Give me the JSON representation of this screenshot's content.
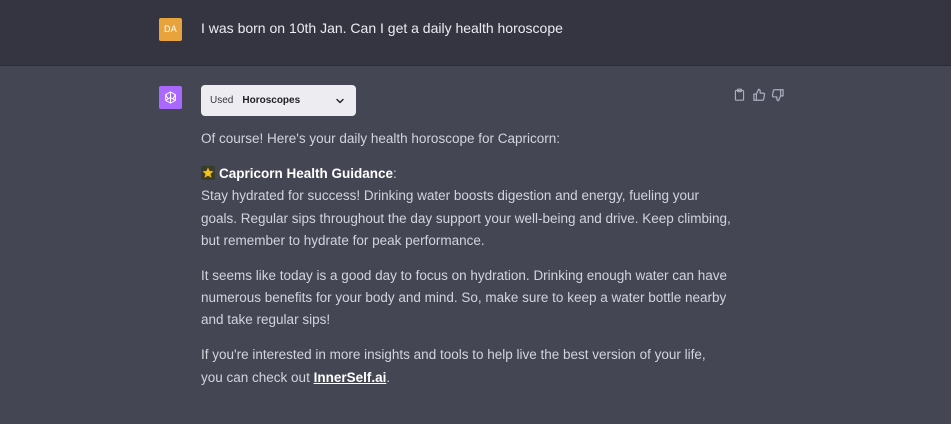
{
  "user_message": {
    "avatar_initials": "DA",
    "avatar_color": "#e8a33d",
    "text": "I was born on 10th Jan. Can I get a daily health horoscope"
  },
  "assistant": {
    "avatar_icon": "openai-logo-icon",
    "avatar_color": "#ab68ff",
    "plugin": {
      "used_label": "Used",
      "name": "Horoscopes",
      "chevron_icon": "chevron-down-icon"
    },
    "actions": [
      {
        "icon": "clipboard-icon"
      },
      {
        "icon": "thumbs-up-icon"
      },
      {
        "icon": "thumbs-down-icon"
      }
    ],
    "intro": "Of course! Here's your daily health horoscope for Capricorn:",
    "guidance": {
      "star_icon": "star-icon",
      "title": "Capricorn Health Guidance",
      "title_suffix": ":",
      "body": "Stay hydrated for success! Drinking water boosts digestion and energy, fueling your goals. Regular sips throughout the day support your well-being and drive. Keep climbing, but remember to hydrate for peak performance."
    },
    "paragraph2": "It seems like today is a good day to focus on hydration. Drinking enough water can have numerous benefits for your body and mind. So, make sure to keep a water bottle nearby and take regular sips!",
    "paragraph3_prefix": "If you're interested in more insights and tools to help live the best version of your life, you can check out ",
    "paragraph3_link": "InnerSelf.ai",
    "paragraph3_suffix": "."
  },
  "colors": {
    "user_row_bg": "#343541",
    "assistant_row_bg": "#444654",
    "text": "#d1d5db"
  }
}
